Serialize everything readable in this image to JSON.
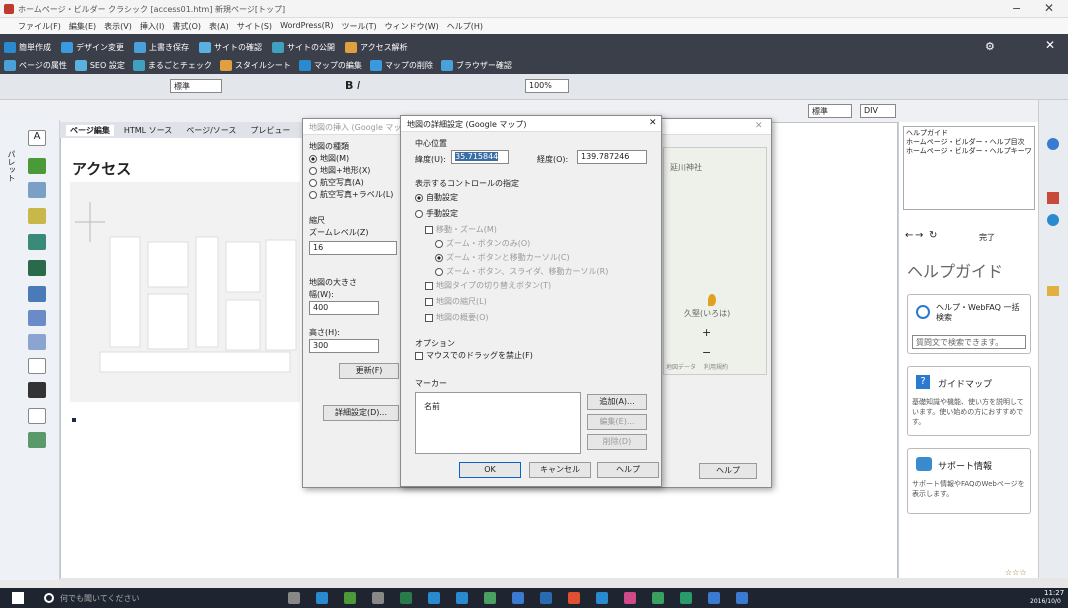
{
  "window": {
    "title": "ホームページ・ビルダー クラシック [access01.htm] 新規ページ[トップ]"
  },
  "menu": [
    "ファイル(F)",
    "編集(E)",
    "表示(V)",
    "挿入(I)",
    "書式(O)",
    "表(A)",
    "サイト(S)",
    "WordPress(R)",
    "ツール(T)",
    "ウィンドウ(W)",
    "ヘルプ(H)"
  ],
  "toolbar_top": [
    "簡単作成",
    "デザイン変更",
    "上書き保存",
    "サイトの確認",
    "サイトの公開",
    "アクセス解析"
  ],
  "toolbar_second": [
    "ページの属性",
    "SEO 設定",
    "まるごとチェック",
    "スタイルシート",
    "マップの編集",
    "マップの削除",
    "ブラウザー確認"
  ],
  "format": {
    "style": "標準",
    "zoom": "100%",
    "font_style": "標準",
    "div": "DIV"
  },
  "editor": {
    "tabs": [
      "ページ編集",
      "HTML ソース",
      "ページ/ソース",
      "プレビュー"
    ],
    "heading": "アクセス"
  },
  "bg_dialog": {
    "title": "地図の挿入 (Google マップ)",
    "map_type_label": "地図の種類",
    "map_types": [
      "地図(M)",
      "地図+地形(X)",
      "航空写真(A)",
      "航空写真+ラベル(L)"
    ],
    "scale_label": "縮尺",
    "zoom_label": "ズームレベル(Z)",
    "zoom_value": "16",
    "size_label": "地図の大きさ",
    "width_label": "幅(W):",
    "width_value": "400",
    "height_label": "高さ(H):",
    "height_value": "300",
    "update_button": "更新(F)",
    "detail_button": "詳細設定(D)...",
    "map_labels": [
      "延川神社",
      "久堅(いろは)",
      "地図データ",
      "利用規約"
    ],
    "help_button": "ヘルプ"
  },
  "dialog": {
    "title": "地図の詳細設定 (Google マップ)",
    "center_label": "中心位置",
    "lat_label": "緯度(U):",
    "lat_value": "35.715844",
    "lng_label": "経度(O):",
    "lng_value": "139.787246",
    "controls_label": "表示するコントロールの指定",
    "auto_label": "自動設定",
    "manual_label": "手動設定",
    "pan_zoom": "移動・ズーム(M)",
    "zoom_only": "ズーム・ボタンのみ(O)",
    "zoom_pan_cursor": "ズーム・ボタンと移動カーソル(C)",
    "zoom_slider": "ズーム・ボタン、スライダ、移動カーソル(R)",
    "map_type_toggle": "地図タイプの切り替えボタン(T)",
    "map_scale": "地図の縮尺(L)",
    "map_overview": "地図の概要(O)",
    "options_label": "オプション",
    "drag_disable": "マウスでのドラッグを禁止(F)",
    "markers_label": "マーカー",
    "name_col": "名前",
    "add_button": "追加(A)...",
    "edit_button": "編集(E)...",
    "delete_button": "削除(D)",
    "ok_button": "OK",
    "cancel_button": "キャンセル",
    "help_button": "ヘルプ"
  },
  "right_panel": {
    "tree_root": "ヘルプガイド",
    "tree_items": [
      "ホームページ・ビルダー・ヘルプ目次",
      "ホームページ・ビルダー・ヘルプキーワード"
    ],
    "nav_label": "完了",
    "help_title": "ヘルプガイド",
    "faq_label": "ヘルプ・WebFAQ 一括検索",
    "search_placeholder": "質問文で検索できます。",
    "guide_title": "ガイドマップ",
    "guide_text": "基礎知識や機能、使い方を説明しています。使い始めの方におすすめです。",
    "support_title": "サポート情報",
    "support_text": "サポート情報やFAQのWebページを表示します。"
  },
  "taskbar": {
    "search_placeholder": "何でも聞いてください",
    "time": "11:27",
    "date": "2016/10/0"
  },
  "colors": {
    "toolbar": "#3b3f4a",
    "taskbar": "#1e2430",
    "accent": "#0a64c8"
  }
}
